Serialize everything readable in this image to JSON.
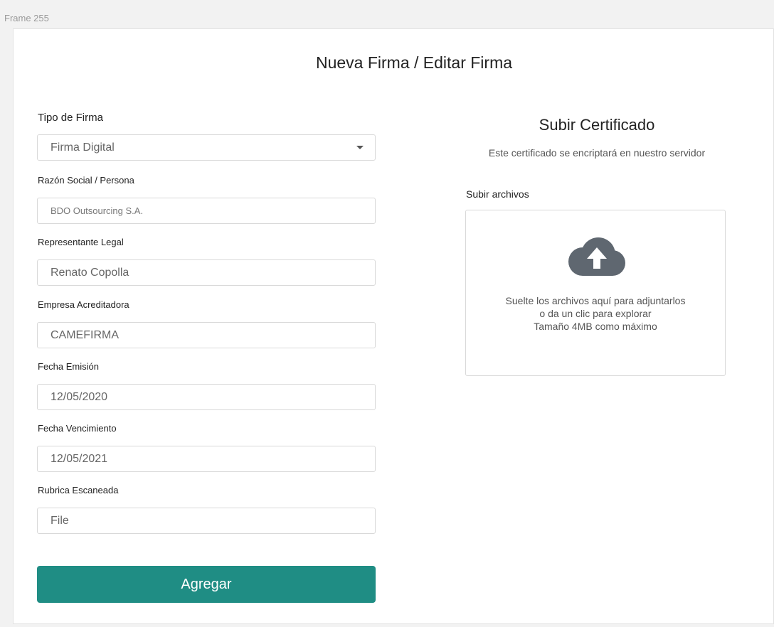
{
  "frame": {
    "label": "Frame 255"
  },
  "page": {
    "title": "Nueva Firma / Editar Firma"
  },
  "form": {
    "signature_type": {
      "label": "Tipo de Firma",
      "value": "Firma Digital"
    },
    "company": {
      "label": "Razón Social / Persona",
      "value": "BDO Outsourcing S.A."
    },
    "legal_rep": {
      "label": "Representante Legal",
      "value": "Renato Copolla"
    },
    "accreditor": {
      "label": "Empresa Acreditadora",
      "value": "CAMEFIRMA"
    },
    "issue_date": {
      "label": "Fecha Emisión",
      "value": "12/05/2020"
    },
    "expiry_date": {
      "label": "Fecha Vencimiento",
      "value": "12/05/2021"
    },
    "scanned_rubric": {
      "label": "Rubrica Escaneada",
      "value": "File"
    },
    "submit_label": "Agregar"
  },
  "certificate": {
    "title": "Subir Certificado",
    "subtitle": "Este certificado se encriptará en nuestro servidor",
    "upload_label": "Subir archivos",
    "drop_line1": "Suelte los archivos aquí para adjuntarlos",
    "drop_line2": "o da un clic para explorar",
    "drop_line3": "Tamaño 4MB como máximo",
    "icon": "cloud-upload-icon"
  },
  "colors": {
    "accent": "#1f8d84",
    "icon": "#5f6770",
    "border": "#d9d9d9"
  }
}
